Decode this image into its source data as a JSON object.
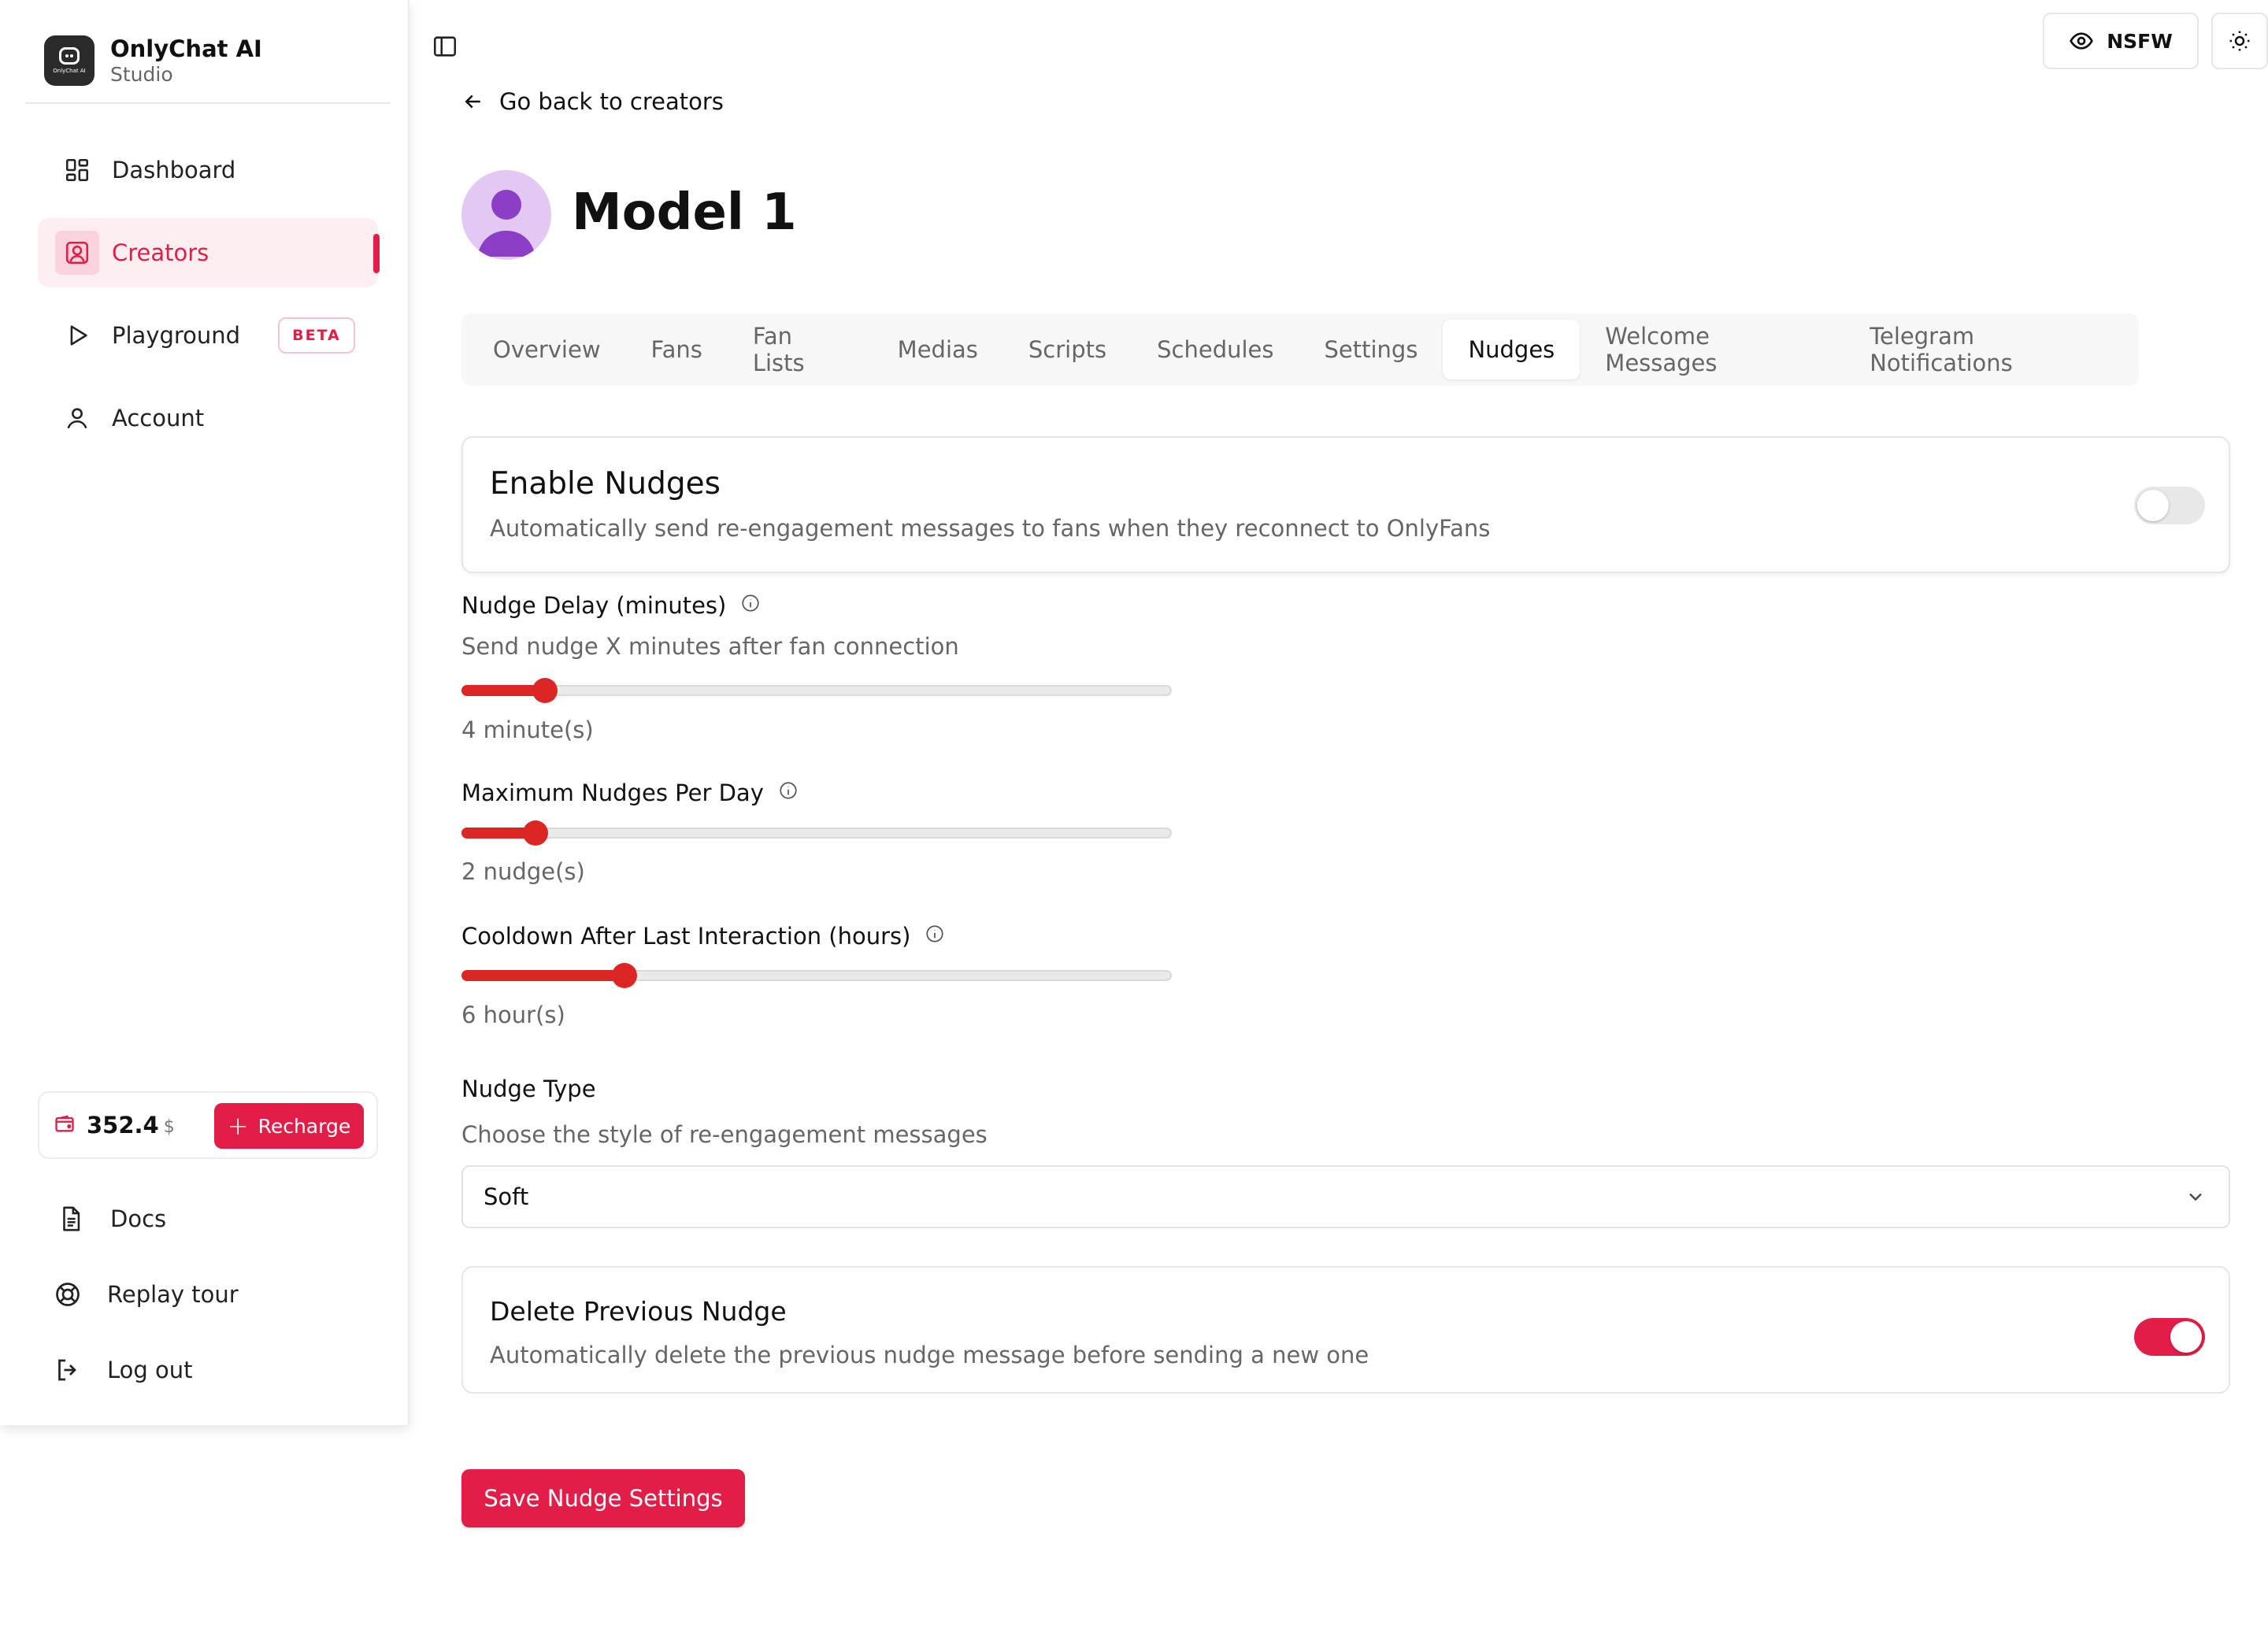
{
  "brand": {
    "name": "OnlyChat AI",
    "subtitle": "Studio",
    "logo_text": "OnlyChat AI"
  },
  "sidebar": {
    "items": [
      {
        "label": "Dashboard",
        "icon": "dashboard-icon"
      },
      {
        "label": "Creators",
        "icon": "creators-icon",
        "active": true
      },
      {
        "label": "Playground",
        "icon": "play-icon",
        "badge": "BETA"
      },
      {
        "label": "Account",
        "icon": "user-icon"
      }
    ],
    "wallet": {
      "amount": "352.4",
      "currency": "$",
      "recharge_label": "Recharge"
    },
    "bottom_items": [
      {
        "label": "Docs",
        "icon": "document-icon"
      },
      {
        "label": "Replay tour",
        "icon": "lifebuoy-icon"
      },
      {
        "label": "Log out",
        "icon": "logout-icon"
      }
    ]
  },
  "topbar": {
    "nsfw_label": "NSFW"
  },
  "back_link": "Go back to creators",
  "page_title": "Model 1",
  "tabs": [
    "Overview",
    "Fans",
    "Fan Lists",
    "Medias",
    "Scripts",
    "Schedules",
    "Settings",
    "Nudges",
    "Welcome Messages",
    "Telegram Notifications"
  ],
  "active_tab": "Nudges",
  "enable_nudges": {
    "title": "Enable Nudges",
    "description": "Automatically send re-engagement messages to fans when they reconnect to OnlyFans",
    "enabled": false
  },
  "nudge_delay": {
    "label": "Nudge Delay (minutes)",
    "help": "Send nudge X minutes after fan connection",
    "value_text": "4 minute(s)",
    "fraction": 0.118
  },
  "max_nudges": {
    "label": "Maximum Nudges Per Day",
    "value_text": "2 nudge(s)",
    "fraction": 0.104
  },
  "cooldown": {
    "label": "Cooldown After Last Interaction (hours)",
    "value_text": "6 hour(s)",
    "fraction": 0.229
  },
  "nudge_type": {
    "label": "Nudge Type",
    "help": "Choose the style of re-engagement messages",
    "selected": "Soft"
  },
  "delete_previous": {
    "title": "Delete Previous Nudge",
    "description": "Automatically delete the previous nudge message before sending a new one",
    "enabled": true
  },
  "save_label": "Save Nudge Settings",
  "colors": {
    "accent": "#e11d48",
    "slider": "#dc2626",
    "avatar_bg": "#e2c8f3",
    "avatar_fg": "#8b3fc6"
  }
}
